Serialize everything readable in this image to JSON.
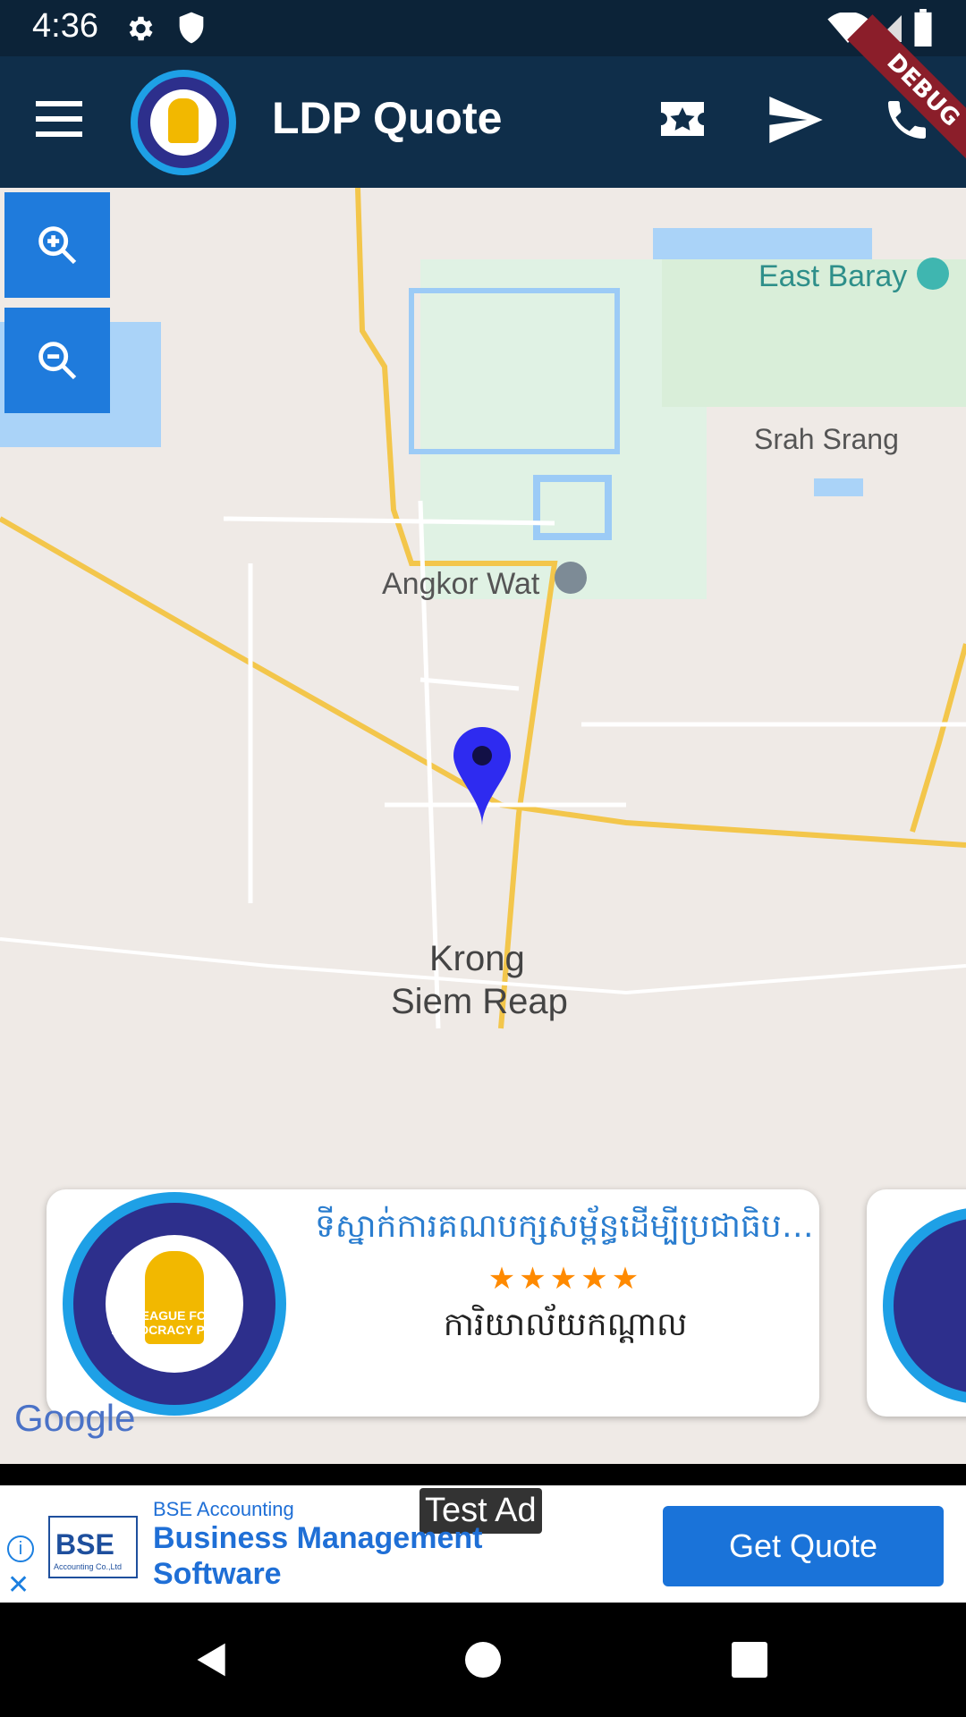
{
  "status_bar": {
    "time": "4:36",
    "icons": [
      "gear-icon",
      "shield-icon",
      "wifi-icon",
      "signal-icon",
      "battery-icon"
    ]
  },
  "app_bar": {
    "title": "LDP Quote",
    "debug_banner": "DEBUG",
    "actions": [
      "quote-icon",
      "send-icon",
      "phone-icon"
    ]
  },
  "map": {
    "labels": {
      "east_baray": "East Baray",
      "srah_srang": "Srah Srang",
      "angkor_wat": "Angkor Wat",
      "krong_line1": "Krong",
      "krong_line2": "Siem Reap"
    },
    "google_logo": "Google"
  },
  "card": {
    "title": "ទីស្នាក់ការគណបក្សសម្ព័ន្ធដើម្បីប្រជាធិបតេយ្យ",
    "stars": "★★★★★",
    "rating": 5,
    "subtitle": "ការិយាល័យកណ្ដាល"
  },
  "logo": {
    "text": "LEAGUE FOR DEMOCRACY PARTY"
  },
  "ad": {
    "badge": "Test Ad",
    "advertiser": "BSE Accounting",
    "headline_line1": "Business Management",
    "headline_line2": "Software",
    "cta": "Get Quote",
    "logo_text": "BSE",
    "logo_sub": "Accounting Co.,Ltd"
  },
  "colors": {
    "appbar": "#0f2e4a",
    "accent_blue": "#1f7bdc",
    "pin": "#2e2bf0",
    "road_yellow": "#f3c64b"
  }
}
